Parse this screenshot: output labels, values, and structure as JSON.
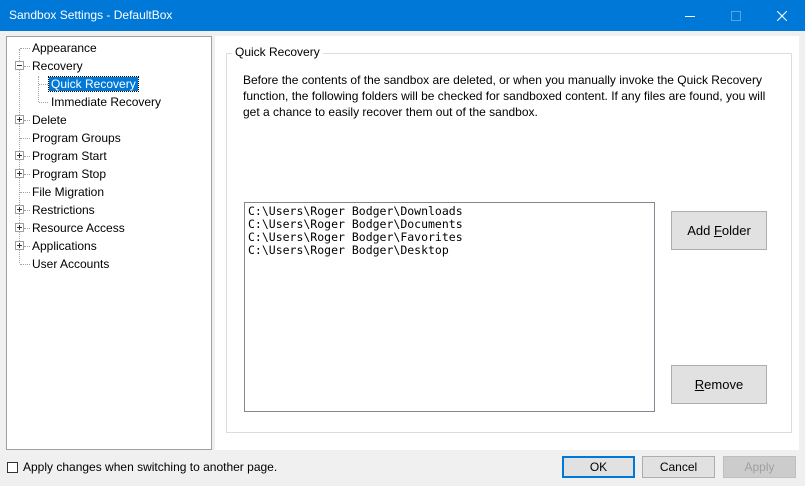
{
  "window": {
    "title": "Sandbox Settings - DefaultBox",
    "controls": [
      "minimize-icon",
      "maximize-icon",
      "close-icon"
    ]
  },
  "tree": {
    "items": [
      {
        "label": "Appearance",
        "expander": "none"
      },
      {
        "label": "Recovery",
        "expander": "minus"
      },
      {
        "label": "Quick Recovery",
        "expander": "none",
        "selected": true
      },
      {
        "label": "Immediate Recovery",
        "expander": "none"
      },
      {
        "label": "Delete",
        "expander": "plus"
      },
      {
        "label": "Program Groups",
        "expander": "none"
      },
      {
        "label": "Program Start",
        "expander": "plus"
      },
      {
        "label": "Program Stop",
        "expander": "plus"
      },
      {
        "label": "File Migration",
        "expander": "none"
      },
      {
        "label": "Restrictions",
        "expander": "plus"
      },
      {
        "label": "Resource Access",
        "expander": "plus"
      },
      {
        "label": "Applications",
        "expander": "plus"
      },
      {
        "label": "User Accounts",
        "expander": "none"
      }
    ]
  },
  "page": {
    "group_title": "Quick Recovery",
    "description": "Before the contents of the sandbox are deleted, or when you manually invoke the Quick Recovery function, the following folders will be checked for sandboxed content.  If any files are found, you will get a chance to easily recover them out of the sandbox.",
    "folders": [
      "C:\\Users\\Roger Bodger\\Downloads",
      "C:\\Users\\Roger Bodger\\Documents",
      "C:\\Users\\Roger Bodger\\Favorites",
      "C:\\Users\\Roger Bodger\\Desktop"
    ],
    "add_folder": {
      "pre": "Add ",
      "mnemonic": "F",
      "post": "older"
    },
    "remove": {
      "pre": "",
      "mnemonic": "R",
      "post": "emove"
    }
  },
  "footer": {
    "apply_changes_label": "Apply changes when switching to another page.",
    "apply_changes_checked": false,
    "ok_label": "OK",
    "cancel_label": "Cancel",
    "apply_label": "Apply",
    "apply_enabled": false
  },
  "colors": {
    "titlebar": "#0078d7",
    "selection": "#0078d7",
    "default_button_border": "#0078d7"
  }
}
